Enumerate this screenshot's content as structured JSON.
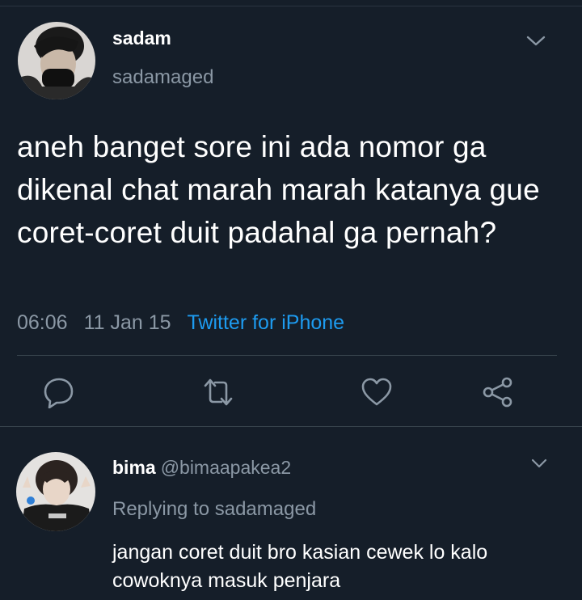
{
  "tweet": {
    "author_name": "sadam",
    "author_handle": "sadamaged",
    "text": "aneh banget sore ini ada nomor ga dikenal chat marah marah katanya gue coret-coret duit padahal ga pernah?",
    "time": "06:06",
    "date": "11 Jan 15",
    "source": "Twitter for iPhone",
    "source_color": "#1d9bf0",
    "actions": [
      "reply-icon",
      "retweet-icon",
      "like-icon",
      "share-icon"
    ]
  },
  "reply": {
    "author_name": "bima",
    "author_handle": "@bimaapakea2",
    "replying_to": "Replying to sadamaged",
    "text": "jangan coret duit bro kasian cewek lo kalo cowoknya masuk penjara"
  },
  "colors": {
    "background": "#151e29",
    "muted_text": "#8b98a5",
    "divider": "#38444d"
  }
}
